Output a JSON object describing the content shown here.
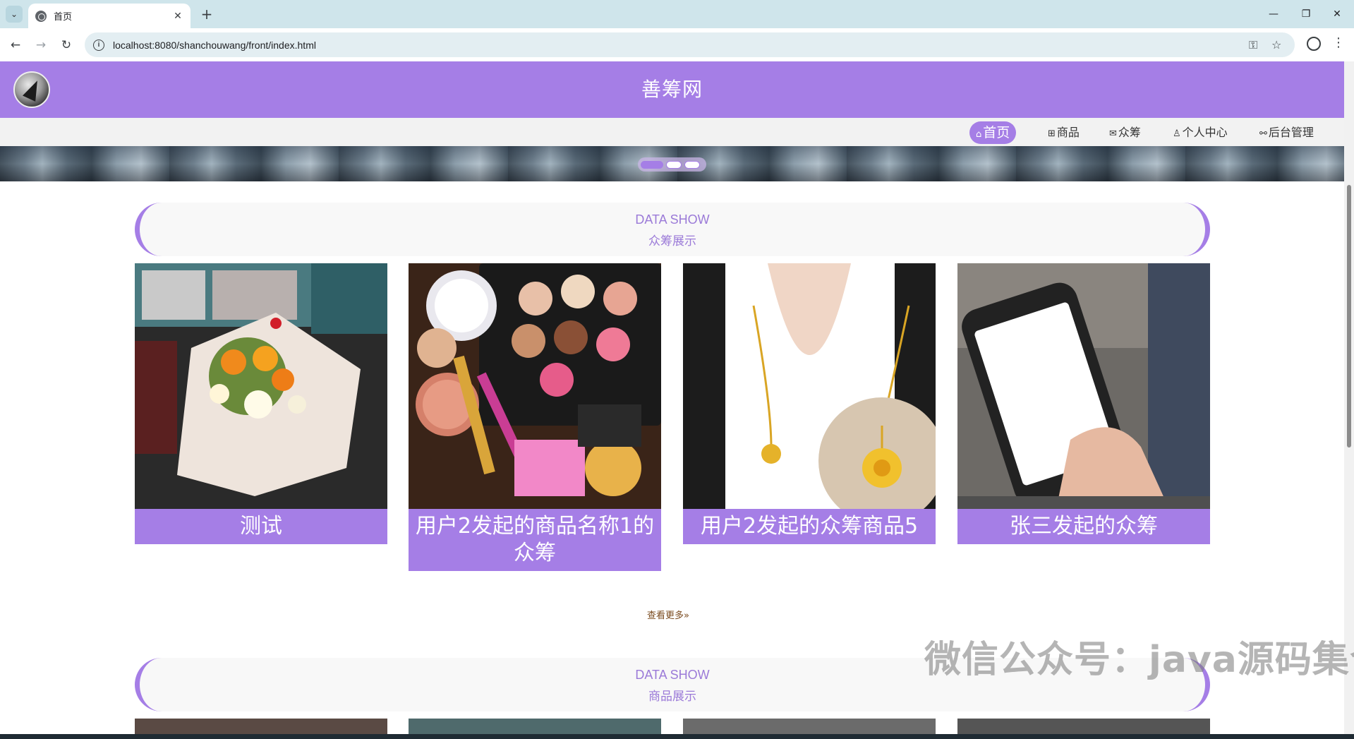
{
  "browser": {
    "tab_title": "首页",
    "url": "localhost:8080/shanchouwang/front/index.html"
  },
  "site": {
    "title": "善筹网"
  },
  "menu": [
    {
      "icon": "home-icon",
      "glyph": "⌂",
      "label": "首页",
      "active": true
    },
    {
      "icon": "gift-icon",
      "glyph": "⊞",
      "label": "商品",
      "active": false
    },
    {
      "icon": "mail-icon",
      "glyph": "✉",
      "label": "众筹",
      "active": false
    },
    {
      "icon": "user-icon",
      "glyph": "♙",
      "label": "个人中心",
      "active": false
    },
    {
      "icon": "link-icon",
      "glyph": "⚯",
      "label": "后台管理",
      "active": false
    }
  ],
  "carousel": {
    "active_index": 0,
    "count": 3
  },
  "crowdfunding_section": {
    "heading_en": "DATA SHOW",
    "heading_cn": "众筹展示",
    "cards": [
      {
        "title": "测试",
        "image": "flower-bouquet-image"
      },
      {
        "title": "用户2发起的商品名称1的众筹",
        "image": "cosmetics-image"
      },
      {
        "title": "用户2发起的众筹商品5",
        "image": "gold-necklace-image"
      },
      {
        "title": "张三发起的众筹",
        "image": "smartphone-image"
      }
    ],
    "more_label": "查看更多»"
  },
  "goods_section": {
    "heading_en": "DATA SHOW",
    "heading_cn": "商品展示"
  },
  "watermark": "微信公众号：java源码集合",
  "colors": {
    "accent": "#a57ee6",
    "menu_bg": "#f2f2f2",
    "section_text": "#9b7ad8"
  }
}
